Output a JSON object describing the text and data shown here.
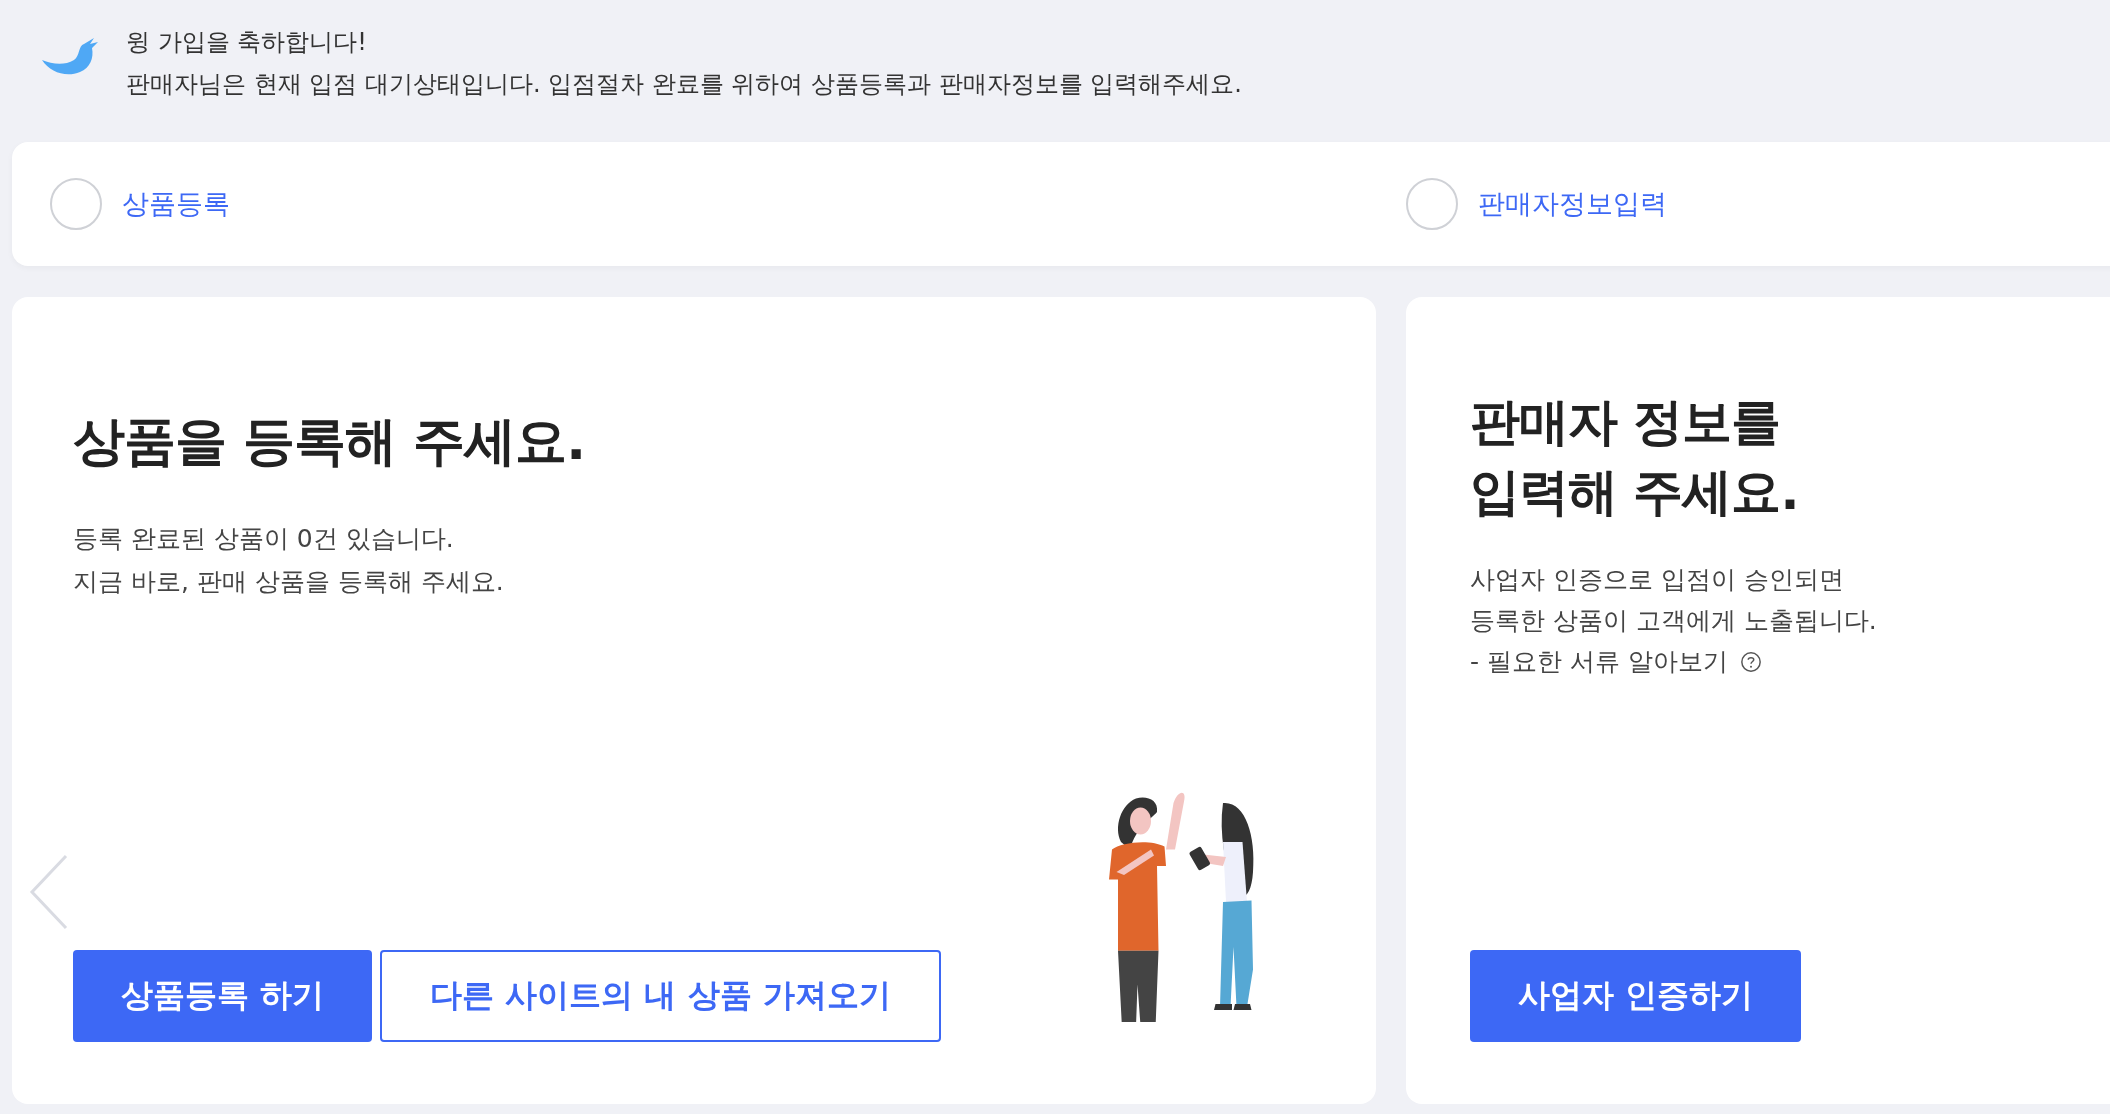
{
  "notice": {
    "title": "윙 가입을 축하합니다!",
    "message": "판매자님은 현재 입점 대기상태입니다. 입점절차 완료를 위하여 상품등록과 판매자정보를 입력해주세요."
  },
  "steps": [
    {
      "label": "상품등록",
      "checked": false
    },
    {
      "label": "판매자정보입력",
      "checked": false
    }
  ],
  "product_card": {
    "title": "상품을 등록해 주세요.",
    "lines": [
      "등록 완료된 상품이 0건 있습니다.",
      "지금 바로, 판매 상품을 등록해 주세요."
    ],
    "buttons": [
      {
        "label": "상품등록 하기",
        "kind": "primary"
      },
      {
        "label": "다른 사이트의 내 상품 가져오기",
        "kind": "outline"
      }
    ]
  },
  "seller_card": {
    "title_lines": [
      "판매자 정보를",
      "입력해 주세요."
    ],
    "lines": [
      "사업자 인증으로 입점이 승인되면",
      "등록한 상품이 고객에게 노출됩니다."
    ],
    "help_link": "- 필요한 서류 알아보기",
    "buttons": [
      {
        "label": "사업자 인증하기",
        "kind": "primary"
      }
    ]
  }
}
